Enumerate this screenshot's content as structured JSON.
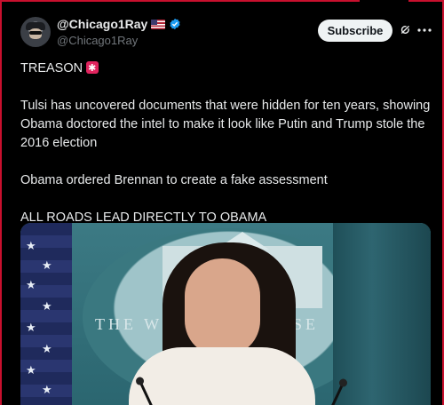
{
  "author": {
    "display_name": "@Chicago1Ray",
    "handle": "@Chicago1Ray"
  },
  "actions": {
    "subscribe_label": "Subscribe"
  },
  "tweet": {
    "line1": "TREASON",
    "line2": "Tulsi has uncovered documents that were hidden for ten years, showing Obama doctored the intel to make it look like Putin and Trump stole the 2016 election",
    "line3": "Obama ordered Brennan to create a fake assessment",
    "line4": "ALL ROADS LEAD DIRECTLY TO OBAMA"
  },
  "media": {
    "backdrop_text_left": "THE W",
    "backdrop_text_right": "USE"
  },
  "icons": {
    "flag": "us-flag-icon",
    "verified": "verified-badge-icon",
    "grok": "grok-icon",
    "more": "more-icon",
    "siren": "siren-emoji"
  },
  "colors": {
    "background": "#000000",
    "text": "#e7e9ea",
    "muted": "#71767b",
    "verified": "#1d9bf0",
    "button_bg": "#eff3f4"
  }
}
